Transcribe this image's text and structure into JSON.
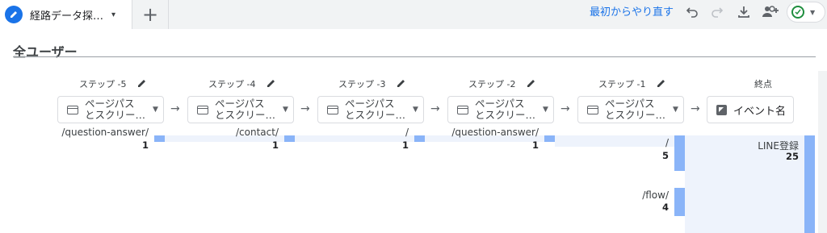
{
  "tab": {
    "title": "経路データ探…",
    "icon": "pencil-icon",
    "caret": "▾"
  },
  "add_tab": {
    "label": "+"
  },
  "toolbar": {
    "restart_label": "最初からやり直す",
    "icons": [
      "undo-icon",
      "redo-icon",
      "download-icon",
      "share-user-icon",
      "status-ok-icon"
    ]
  },
  "segment": {
    "title": "全ユーザー"
  },
  "steps": [
    {
      "label": "ステップ -5",
      "dimension": "ページパス\nとスクリー…"
    },
    {
      "label": "ステップ -4",
      "dimension": "ページパス\nとスクリー…"
    },
    {
      "label": "ステップ -3",
      "dimension": "ページパス\nとスクリー…"
    },
    {
      "label": "ステップ -2",
      "dimension": "ページパス\nとスクリー…"
    },
    {
      "label": "ステップ -1",
      "dimension": "ページパス\nとスクリー…"
    }
  ],
  "endpoint": {
    "label": "終点",
    "dimension": "イベント名"
  },
  "nodes": {
    "step5": {
      "path": "/question-answer/",
      "count": "1"
    },
    "step4": {
      "path": "/contact/",
      "count": "1"
    },
    "step3": {
      "path": "/",
      "count": "1"
    },
    "step2": {
      "path": "/question-answer/",
      "count": "1"
    },
    "step1_a": {
      "path": "/",
      "count": "5"
    },
    "step1_b": {
      "path": "/flow/",
      "count": "4"
    },
    "end": {
      "event": "LINE登録",
      "count": "25"
    }
  },
  "colors": {
    "accent": "#1a73e8",
    "bar": "#8ab4f8",
    "flow": "#eef3fc",
    "ok": "#1e8e3e"
  }
}
